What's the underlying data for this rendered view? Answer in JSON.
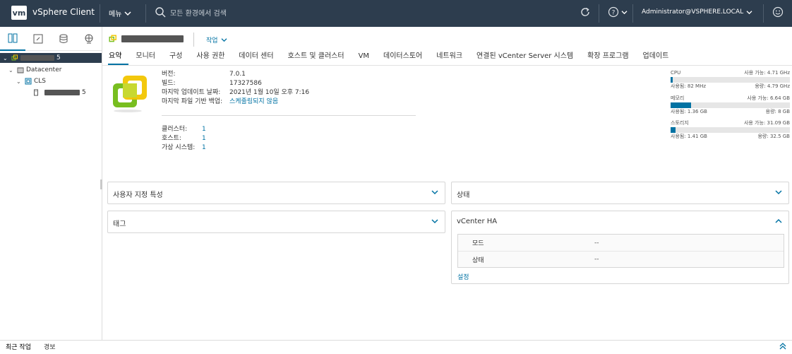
{
  "header": {
    "logo_text": "vm",
    "app_title": "vSphere Client",
    "menu_label": "메뉴",
    "search_placeholder": "모든 환경에서 검색",
    "user_label": "Administrator@VSPHERE.LOCAL",
    "icons": [
      "refresh-icon",
      "help-icon",
      "smiley-icon"
    ]
  },
  "leftnav": {
    "icons": [
      "hosts-clusters-icon",
      "vms-templates-icon",
      "storage-icon",
      "networking-icon"
    ],
    "tree": {
      "root_suffix": "5",
      "datacenter": "Datacenter",
      "cluster": "CLS",
      "host_suffix": "5"
    }
  },
  "main": {
    "actions_label": "작업",
    "tabs": [
      "요약",
      "모니터",
      "구성",
      "사용 권한",
      "데이터 센터",
      "호스트 및 클러스터",
      "VM",
      "데이터스토어",
      "네트워크",
      "연결된 vCenter Server 시스템",
      "확장 프로그램",
      "업데이트"
    ],
    "info": [
      {
        "label": "버전:",
        "value": "7.0.1"
      },
      {
        "label": "빌드:",
        "value": "17327586"
      },
      {
        "label": "마지막 업데이트 날짜:",
        "value": "2021년 1월 10일 오후 7:16"
      },
      {
        "label": "마지막 파일 기반 백업:",
        "value": "스케줄링되지 않음"
      }
    ],
    "counts": [
      {
        "label": "클러스터:",
        "value": "1"
      },
      {
        "label": "호스트:",
        "value": "1"
      },
      {
        "label": "가상 시스템:",
        "value": "1"
      }
    ],
    "resources": [
      {
        "name": "CPU",
        "free": "사용 가능: 4.71 GHz",
        "used": "사용됨: 82 MHz",
        "capacity": "용량: 4.79 GHz",
        "fraction": 0.017
      },
      {
        "name": "메모리",
        "free": "사용 가능: 6.64 GB",
        "used": "사용됨: 1.36 GB",
        "capacity": "용량: 8 GB",
        "fraction": 0.17
      },
      {
        "name": "스토리지",
        "free": "사용 가능: 31.09 GB",
        "used": "사용됨: 1.41 GB",
        "capacity": "용량: 32.5 GB",
        "fraction": 0.043
      }
    ],
    "cards": {
      "custom_attributes": "사용자 지정 특성",
      "status": "상태",
      "tags": "태그",
      "vcenter_ha": {
        "title": "vCenter HA",
        "rows": [
          {
            "key": "모드",
            "value": "--"
          },
          {
            "key": "상태",
            "value": "--"
          }
        ],
        "settings_link": "설정"
      }
    }
  },
  "bottom": {
    "tabs": [
      "최근 작업",
      "경보"
    ]
  },
  "colors": {
    "header_bg": "#2d3d4e",
    "accent": "#0072a3",
    "logo_green": "#78be20",
    "logo_yellow": "#f2c500"
  }
}
